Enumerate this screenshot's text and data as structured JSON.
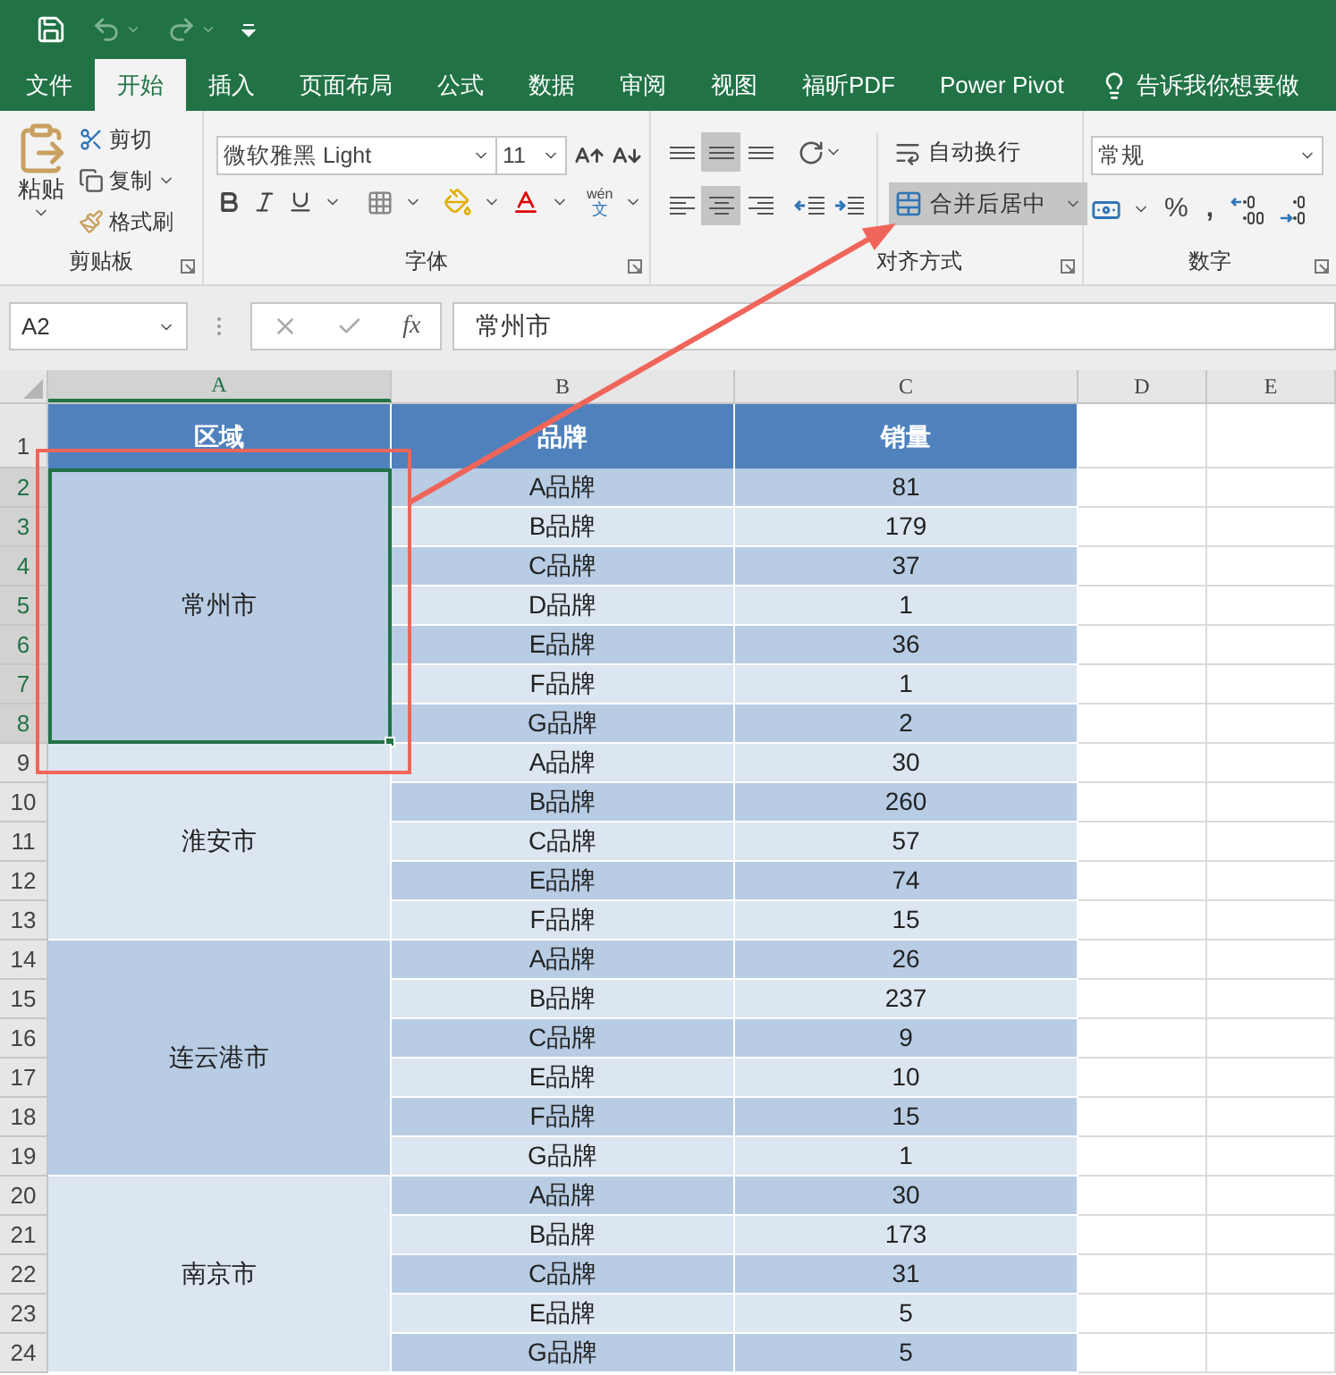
{
  "tabs": [
    {
      "label": "文件",
      "selected": false
    },
    {
      "label": "开始",
      "selected": true
    },
    {
      "label": "插入",
      "selected": false
    },
    {
      "label": "页面布局",
      "selected": false
    },
    {
      "label": "公式",
      "selected": false
    },
    {
      "label": "数据",
      "selected": false
    },
    {
      "label": "审阅",
      "selected": false
    },
    {
      "label": "视图",
      "selected": false
    },
    {
      "label": "福昕PDF",
      "selected": false
    },
    {
      "label": "Power Pivot",
      "selected": false
    }
  ],
  "tell_me": "告诉我你想要做",
  "clipboard": {
    "label": "剪贴板",
    "paste": "粘贴",
    "cut": "剪切",
    "copy": "复制",
    "format_painter": "格式刷"
  },
  "font": {
    "label": "字体",
    "font_name": "微软雅黑 Light",
    "font_size": "11",
    "phonetic_top": "wén",
    "phonetic_bottom": "文"
  },
  "alignment": {
    "label": "对齐方式",
    "wrap_text": "自动换行",
    "merge_center": {
      "label": "合并后居中",
      "selected": true
    },
    "buttons": [
      {
        "kind": "top",
        "selected": false
      },
      {
        "kind": "middle",
        "selected": true
      },
      {
        "kind": "bottom",
        "selected": false
      },
      {
        "kind": "left",
        "selected": false
      },
      {
        "kind": "center",
        "selected": true
      },
      {
        "kind": "right",
        "selected": false
      }
    ]
  },
  "number": {
    "label": "数字",
    "format": "常规",
    "percent": "%",
    "comma": ","
  },
  "formula_bar": {
    "name_box": "A2",
    "function_label": "fx",
    "value": "常州市"
  },
  "columns": [
    {
      "label": "A",
      "selected": true
    },
    {
      "label": "B",
      "selected": false
    },
    {
      "label": "C",
      "selected": false
    },
    {
      "label": "D",
      "selected": false
    },
    {
      "label": "E",
      "selected": false
    }
  ],
  "table": {
    "header_row": "1",
    "headers": [
      "区域",
      "品牌",
      "销量"
    ],
    "groups": [
      {
        "region": "常州市",
        "selected": true,
        "rows": [
          {
            "row": "2",
            "brand": "A品牌",
            "sales": "81"
          },
          {
            "row": "3",
            "brand": "B品牌",
            "sales": "179"
          },
          {
            "row": "4",
            "brand": "C品牌",
            "sales": "37"
          },
          {
            "row": "5",
            "brand": "D品牌",
            "sales": "1"
          },
          {
            "row": "6",
            "brand": "E品牌",
            "sales": "36"
          },
          {
            "row": "7",
            "brand": "F品牌",
            "sales": "1"
          },
          {
            "row": "8",
            "brand": "G品牌",
            "sales": "2"
          }
        ]
      },
      {
        "region": "淮安市",
        "selected": false,
        "rows": [
          {
            "row": "9",
            "brand": "A品牌",
            "sales": "30"
          },
          {
            "row": "10",
            "brand": "B品牌",
            "sales": "260"
          },
          {
            "row": "11",
            "brand": "C品牌",
            "sales": "57"
          },
          {
            "row": "12",
            "brand": "E品牌",
            "sales": "74"
          },
          {
            "row": "13",
            "brand": "F品牌",
            "sales": "15"
          }
        ]
      },
      {
        "region": "连云港市",
        "selected": false,
        "rows": [
          {
            "row": "14",
            "brand": "A品牌",
            "sales": "26"
          },
          {
            "row": "15",
            "brand": "B品牌",
            "sales": "237"
          },
          {
            "row": "16",
            "brand": "C品牌",
            "sales": "9"
          },
          {
            "row": "17",
            "brand": "E品牌",
            "sales": "10"
          },
          {
            "row": "18",
            "brand": "F品牌",
            "sales": "15"
          },
          {
            "row": "19",
            "brand": "G品牌",
            "sales": "1"
          }
        ]
      },
      {
        "region": "南京市",
        "selected": false,
        "rows": [
          {
            "row": "20",
            "brand": "A品牌",
            "sales": "30"
          },
          {
            "row": "21",
            "brand": "B品牌",
            "sales": "173"
          },
          {
            "row": "22",
            "brand": "C品牌",
            "sales": "31"
          },
          {
            "row": "23",
            "brand": "E品牌",
            "sales": "5"
          },
          {
            "row": "24",
            "brand": "G品牌",
            "sales": "5"
          }
        ]
      }
    ]
  }
}
